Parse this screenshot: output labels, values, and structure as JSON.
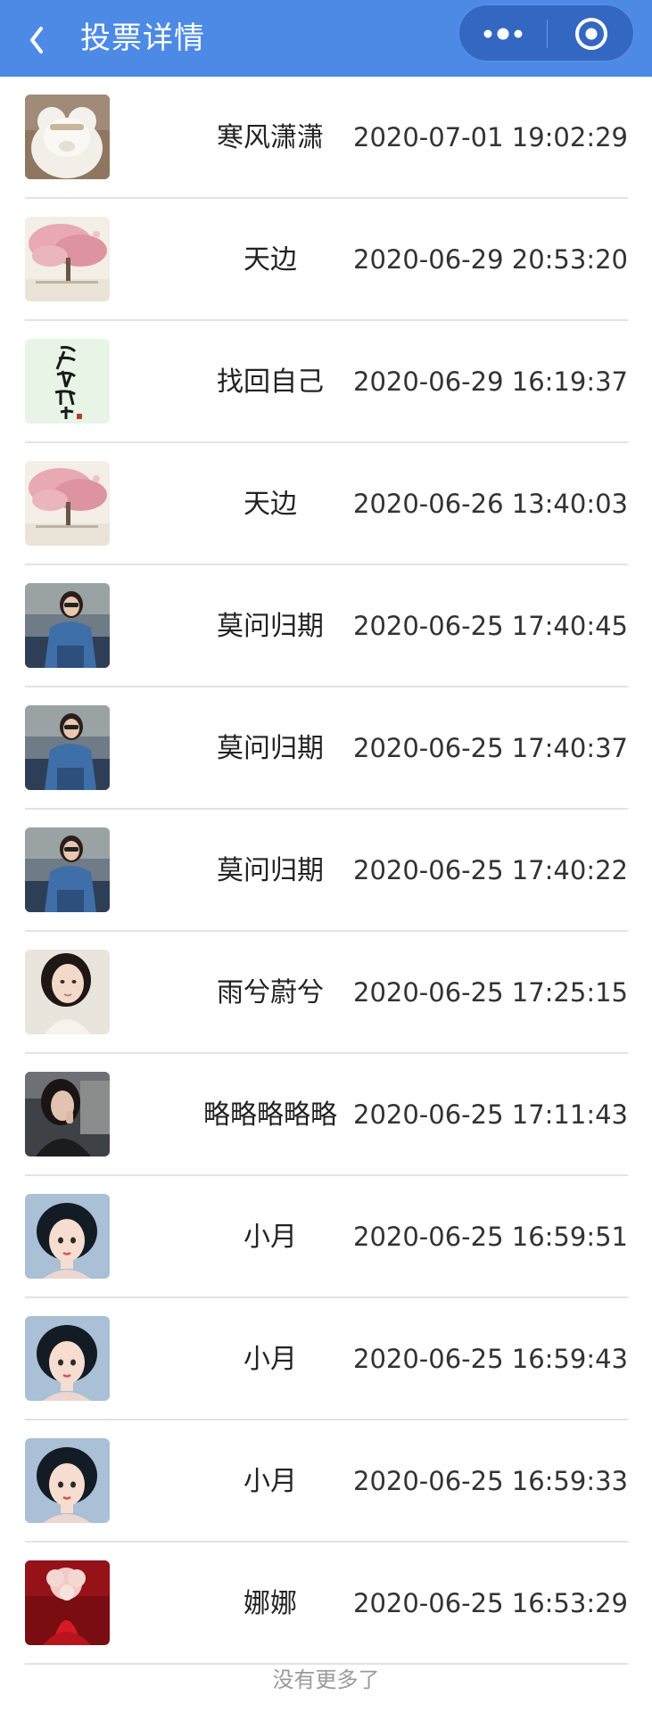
{
  "header": {
    "title": "投票详情",
    "background_color": "#4c8ae6",
    "back_icon": "chevron-left-icon",
    "more_icon": "more-dots-icon",
    "close_icon": "target-close-icon"
  },
  "votes": [
    {
      "name": "寒风潇潇",
      "time": "2020-07-01 19:02:29",
      "avatar": "white-plush-toy"
    },
    {
      "name": "天边",
      "time": "2020-06-29 20:53:20",
      "avatar": "pink-blossom-tree"
    },
    {
      "name": "找回自己",
      "time": "2020-06-29 16:19:37",
      "avatar": "calligraphy-text"
    },
    {
      "name": "天边",
      "time": "2020-06-26 13:40:03",
      "avatar": "pink-blossom-tree"
    },
    {
      "name": "莫问归期",
      "time": "2020-06-25 17:40:45",
      "avatar": "girl-denim-jacket"
    },
    {
      "name": "莫问归期",
      "time": "2020-06-25 17:40:37",
      "avatar": "girl-denim-jacket"
    },
    {
      "name": "莫问归期",
      "time": "2020-06-25 17:40:22",
      "avatar": "girl-denim-jacket"
    },
    {
      "name": "雨兮蔚兮",
      "time": "2020-06-25 17:25:15",
      "avatar": "woman-portrait"
    },
    {
      "name": "略略略略略",
      "time": "2020-06-25 17:11:43",
      "avatar": "girl-dark-portrait"
    },
    {
      "name": "小月",
      "time": "2020-06-25 16:59:51",
      "avatar": "cartoon-bob-hair-girl"
    },
    {
      "name": "小月",
      "time": "2020-06-25 16:59:43",
      "avatar": "cartoon-bob-hair-girl"
    },
    {
      "name": "小月",
      "time": "2020-06-25 16:59:33",
      "avatar": "cartoon-bob-hair-girl"
    },
    {
      "name": "娜娜",
      "time": "2020-06-25 16:53:29",
      "avatar": "red-dress-girl"
    }
  ],
  "footer": {
    "no_more_text": "没有更多了"
  }
}
